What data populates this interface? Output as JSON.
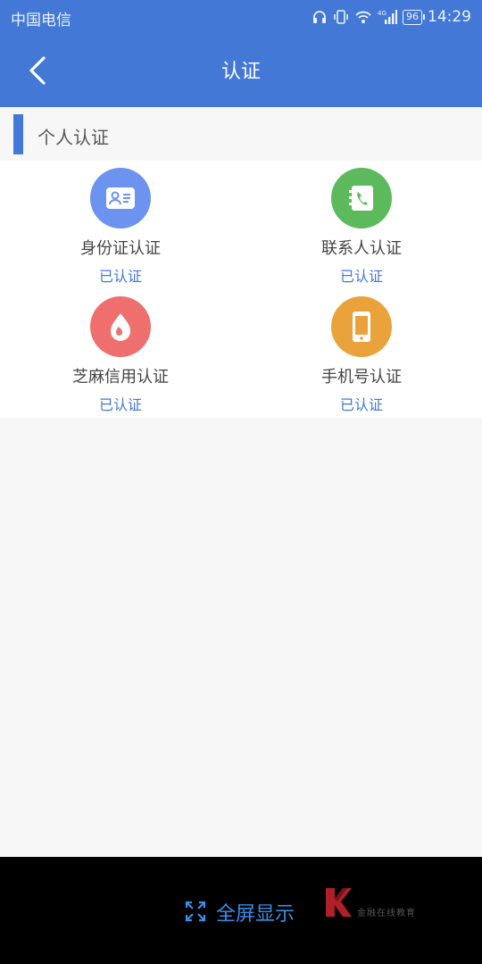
{
  "status_bar": {
    "carrier": "中国电信",
    "battery": "96",
    "time": "14:29",
    "network": "4G"
  },
  "header": {
    "title": "认证",
    "back_icon": "chevron-left-icon"
  },
  "section": {
    "title": "个人认证"
  },
  "items": [
    {
      "label": "身份证认证",
      "status": "已认证",
      "icon": "id-card-icon",
      "color": "#6b93ef"
    },
    {
      "label": "联系人认证",
      "status": "已认证",
      "icon": "contact-phone-icon",
      "color": "#5cba5c"
    },
    {
      "label": "芝麻信用认证",
      "status": "已认证",
      "icon": "sesame-credit-icon",
      "color": "#ef6f6f"
    },
    {
      "label": "手机号认证",
      "status": "已认证",
      "icon": "mobile-phone-icon",
      "color": "#eaa23b"
    }
  ],
  "bottom_bar": {
    "fullscreen_label": "全屏显示",
    "logo_text": "金融在线教育"
  },
  "colors": {
    "primary": "#4378d6",
    "status_text": "#4378d6",
    "fullscreen_text": "#3a8ee6"
  }
}
